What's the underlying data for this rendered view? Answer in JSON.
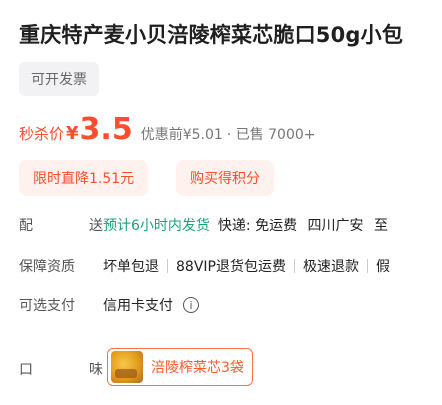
{
  "product": {
    "title": "重庆特产麦小贝涪陵榨菜芯脆口50g小包"
  },
  "invoice_badge": "可开发票",
  "price": {
    "label": "秒杀价",
    "currency": "¥",
    "value": "3.5",
    "original_label": "优惠前¥5.01",
    "sold_text": "· 已售 7000+"
  },
  "promotions": [
    {
      "label": "限时直降1.51元"
    },
    {
      "label": "购买得积分"
    }
  ],
  "shipping": {
    "label_chars": [
      "配",
      "送"
    ],
    "time": "预计6小时内发货",
    "courier": "快递: 免运费",
    "origin": "四川广安",
    "to": "至"
  },
  "guarantee": {
    "label": "保障资质",
    "items": [
      "坏单包退",
      "88VIP退货包运费",
      "极速退款",
      "假"
    ]
  },
  "payment": {
    "label": "可选支付",
    "method": "信用卡支付"
  },
  "flavor": {
    "label_chars": [
      "口",
      "味"
    ],
    "selected": "涪陵榨菜芯3袋"
  },
  "colors": {
    "accent": "#ff4d2e",
    "ship_green": "#1aa37a"
  }
}
